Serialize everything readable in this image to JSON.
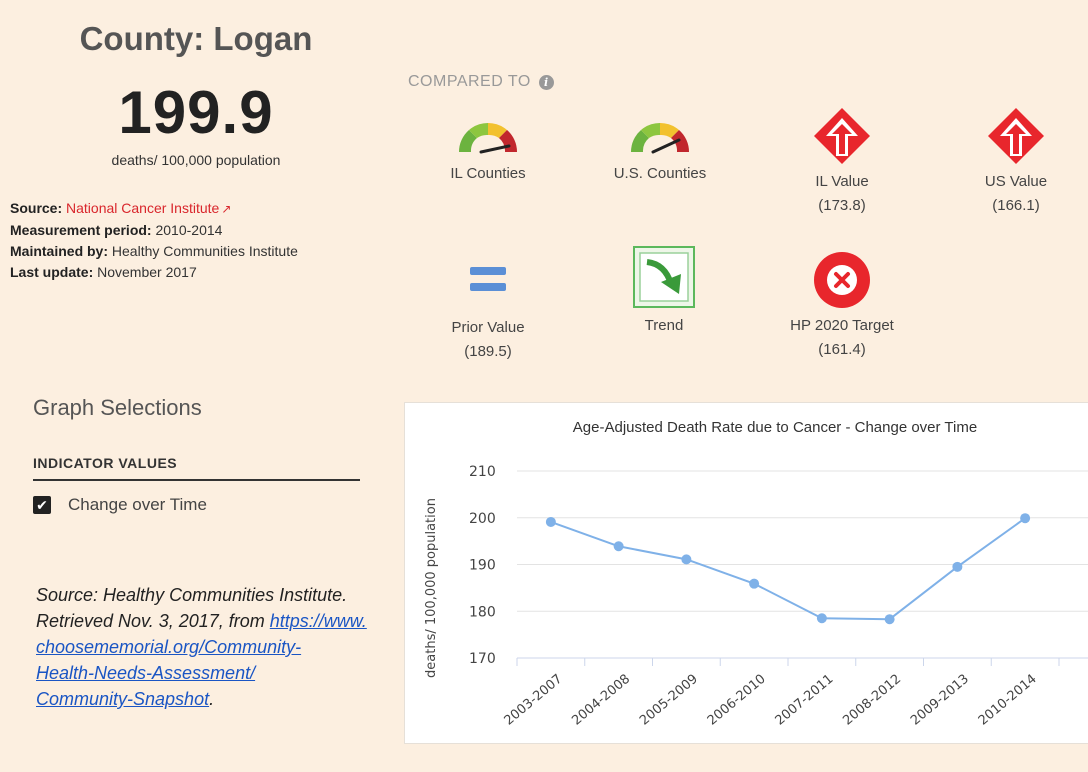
{
  "county": {
    "title": "County: Logan",
    "value": "199.9",
    "unit": "deaths/ 100,000 population"
  },
  "meta": {
    "source_label": "Source:",
    "source_value": "National Cancer Institute",
    "period_label": "Measurement period:",
    "period_value": "2010-2014",
    "maintained_label": "Maintained by:",
    "maintained_value": "Healthy Communities Institute",
    "update_label": "Last update:",
    "update_value": "November 2017"
  },
  "compared": {
    "heading": "COMPARED TO",
    "items": [
      {
        "label": "IL Counties",
        "sub": "",
        "icon": "gauge-icon"
      },
      {
        "label": "U.S. Counties",
        "sub": "",
        "icon": "gauge-icon"
      },
      {
        "label": "IL Value",
        "sub": "(173.8)",
        "icon": "red-up-arrow-icon"
      },
      {
        "label": "US Value",
        "sub": "(166.1)",
        "icon": "red-up-arrow-icon"
      },
      {
        "label": "Prior Value",
        "sub": "(189.5)",
        "icon": "equals-icon"
      },
      {
        "label": "Trend",
        "sub": "",
        "icon": "trend-arrow-icon"
      },
      {
        "label": "HP 2020 Target",
        "sub": "(161.4)",
        "icon": "red-x-circle-icon"
      }
    ]
  },
  "graph_selections": {
    "heading": "Graph Selections",
    "section": "INDICATOR VALUES",
    "option": "Change over Time",
    "checked": true
  },
  "source_note": {
    "text": "Source: Healthy Communities Institute. Retrieved Nov. 3, 2017, from ",
    "link": "https://www.choosememorial.org/Community-Health-Needs-Assessment/Community-Snapshot",
    "link_lines": [
      "https://www.",
      "choosememorial.org/Community-",
      "Health-Needs-Assessment/",
      "Community-Snapshot"
    ],
    "trail": "."
  },
  "colors": {
    "panel_bg": "#fcefe0",
    "accent_red": "#d9262c",
    "line_blue": "#7fb1e8",
    "equals_blue": "#5b8fd6",
    "trend_green": "#5cb85c"
  },
  "chart_data": {
    "type": "line",
    "title": "Age-Adjusted Death Rate due to Cancer - Change over Time",
    "ylabel": "deaths/ 100,000 population",
    "xlabel": "",
    "categories": [
      "2003-2007",
      "2004-2008",
      "2005-2009",
      "2006-2010",
      "2007-2011",
      "2008-2012",
      "2009-2013",
      "2010-2014"
    ],
    "series": [
      {
        "values": [
          199.1,
          193.9,
          191.1,
          185.9,
          178.5,
          178.3,
          189.5,
          199.9
        ]
      }
    ],
    "yticks": [
      170,
      180,
      190,
      200,
      210
    ],
    "ylim": [
      170,
      210
    ],
    "grid": true
  }
}
